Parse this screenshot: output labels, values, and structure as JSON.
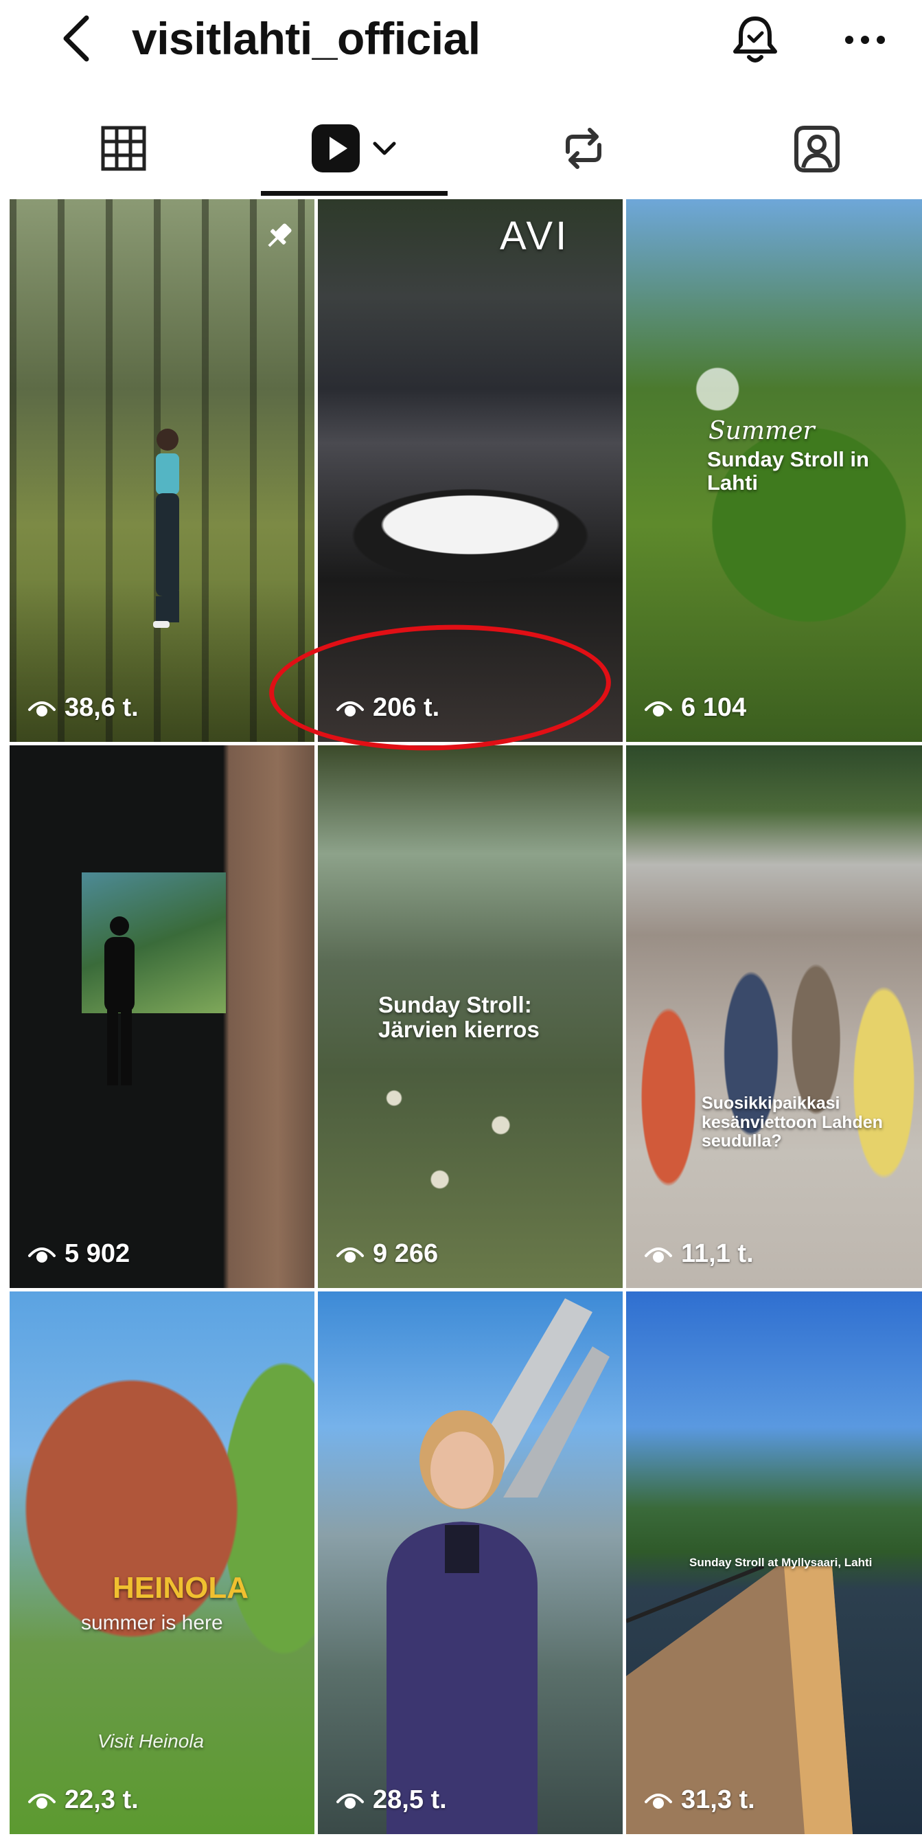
{
  "header": {
    "title": "visitlahti_official"
  },
  "icons": {
    "back": "chevron-left-icon",
    "bell": "bell-icon",
    "more": "more-horizontal-icon",
    "grid": "grid-icon",
    "reels": "reels-play-icon",
    "reposts": "repost-icon",
    "tagged": "tagged-user-icon",
    "views": "eye-icon",
    "pin": "pin-icon"
  },
  "colors": {
    "accent_ring": "#e10f15",
    "tab_active": "#111111"
  },
  "reels": [
    {
      "views": "38,6 t.",
      "overlay": "",
      "pinned": true
    },
    {
      "views": "206 t.",
      "overlay": "AVI",
      "highlighted": true
    },
    {
      "views": "6 104",
      "overlay_script": "Summer",
      "overlay": "Sunday Stroll in Lahti"
    },
    {
      "views": "5 902",
      "overlay": ""
    },
    {
      "views": "9 266",
      "overlay": "Sunday Stroll: Järvien kierros"
    },
    {
      "views": "11,1 t.",
      "overlay": "Suosikkipaikkasi kesänviettoon Lahden seudulla?"
    },
    {
      "views": "22,3 t.",
      "overlay": "HEINOLA",
      "overlay_sub": "summer is here",
      "logo": "Visit Heinola"
    },
    {
      "views": "28,5 t.",
      "overlay": ""
    },
    {
      "views": "31,3 t.",
      "overlay": "Sunday Stroll at Myllysaari, Lahti"
    }
  ]
}
